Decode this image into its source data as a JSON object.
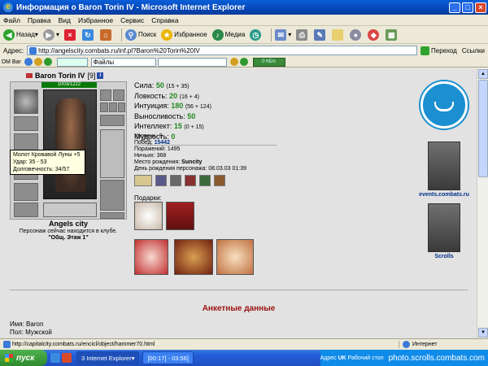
{
  "window": {
    "title": "Информация о Baron Torin IV - Microsoft Internet Explorer"
  },
  "menu": [
    "Файл",
    "Правка",
    "Вид",
    "Избранное",
    "Сервис",
    "Справка"
  ],
  "toolbar": {
    "back": "Назад",
    "search": "Поиск",
    "favorites": "Избранное",
    "media": "Медиа"
  },
  "address": {
    "label": "Адрес:",
    "url": "http://angelscity.combats.ru/inf.pl?Baron%20Torin%20IV",
    "go": "Переход",
    "links": "Ссылки"
  },
  "dmbar": {
    "label": "DM Bar",
    "files": "Файлы",
    "meter": "0 КБ/с"
  },
  "character": {
    "name": "Baron Torin IV",
    "level": "[9]",
    "hp": "1003/1222",
    "city": "Angels city",
    "location_text": "Персонаж сейчас находится в клубе.",
    "room": "\"Общ. Этаж 1\""
  },
  "tooltip": {
    "line1": "Молот Кровавой Луны +5",
    "line2": "Удар: 35 - 53",
    "line3": "Долговечность: 34/57"
  },
  "stats": [
    {
      "label": "Сила:",
      "value": "50",
      "bonus": "(15 + 35)"
    },
    {
      "label": "Ловкость:",
      "value": "20",
      "bonus": "(16 + 4)"
    },
    {
      "label": "Интуиция:",
      "value": "180",
      "bonus": "(56 + 124)"
    },
    {
      "label": "Выносливость:",
      "value": "50",
      "bonus": ""
    },
    {
      "label": "Интеллект:",
      "value": "15",
      "bonus": "(0 + 15)"
    },
    {
      "label": "Мудрость:",
      "value": "0",
      "bonus": ""
    }
  ],
  "info": {
    "level_label": "Уровень:",
    "level": "9",
    "wins_label": "Побед:",
    "wins": "15442",
    "losses_label": "Поражений:",
    "losses": "1495",
    "draws_label": "Ничьих:",
    "draws": "368",
    "birthplace_label": "Место рождения:",
    "birthplace": "Suncity",
    "birthday_label": "День рождения персонажа:",
    "birthday": "08.03.03 01:39"
  },
  "gifts_label": "Подарки:",
  "sidebar": {
    "events_link": "events.combats.ru",
    "scrolls_link": "Scrolls"
  },
  "profile": {
    "title": "Анкетные данные",
    "name_label": "Имя:",
    "name": "Baron",
    "sex_label": "Пол:",
    "sex": "Мужской"
  },
  "status": {
    "url": "http://capitalcity.combats.ru/encicl/object/hammer70.html",
    "zone": "Интернет"
  },
  "taskbar": {
    "start": "пуск",
    "task1": "3 Internet Explorer",
    "task2": "[00:17] - 03:56]",
    "tray_addr": "Адрес",
    "tray_lang": "UK",
    "tray_desk": "Рабочий стол",
    "watermark": "photo.scrolls.combats.com"
  }
}
